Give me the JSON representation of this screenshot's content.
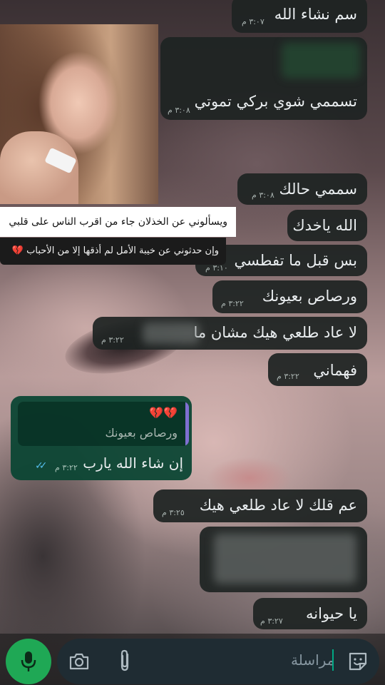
{
  "messages": [
    {
      "text": "سم نشاء الله",
      "time": "٣:٠٧ م"
    },
    {
      "text": "تسممي شوي بركي تموتي",
      "time": "٣:٠٨ م"
    },
    {
      "text": "سممي حالك",
      "time": "٣:٠٨ م"
    },
    {
      "text": "الله ياخدك",
      "time": ""
    },
    {
      "text": "بس قبل ما تفطسي",
      "time": "٣:١٠ م"
    },
    {
      "text": "ورصاص بعيونك",
      "time": "٣:٢٢ م"
    },
    {
      "text": "لا عاد طلعي هيك مشان ما",
      "time": "٣:٢٢ م"
    },
    {
      "text": "فهماني",
      "time": "٣:٢٢ م"
    },
    {
      "text": "عم قلك لا عاد طلعي هيك",
      "time": "٣:٢٥ م"
    },
    {
      "text": "يا حيوانه",
      "time": "٣:٢٧ م"
    }
  ],
  "sent": {
    "quote_emoji": "💔💔",
    "quote_text": "ورصاص بعيونك",
    "text": "إن شاء الله يارب",
    "time": "٣:٢٢ م",
    "ticks": "✓✓"
  },
  "overlay": {
    "caption_line1": "ويسألوني عن الخذلان جاء من اقرب الناس على قلبي",
    "caption_line2": "وإن حدثوني عن خيبة الأمل لم أذقها إلا من الأحباب 💔"
  },
  "input": {
    "placeholder": "مراسلة"
  },
  "icons": {
    "mic": "microphone-icon",
    "camera": "camera-icon",
    "attach": "paperclip-icon",
    "sticker": "sticker-icon"
  },
  "colors": {
    "received_bubble": "#1e2422",
    "sent_bubble": "#0c4634",
    "mic_button": "#1fa855",
    "read_ticks": "#53bdeb"
  }
}
